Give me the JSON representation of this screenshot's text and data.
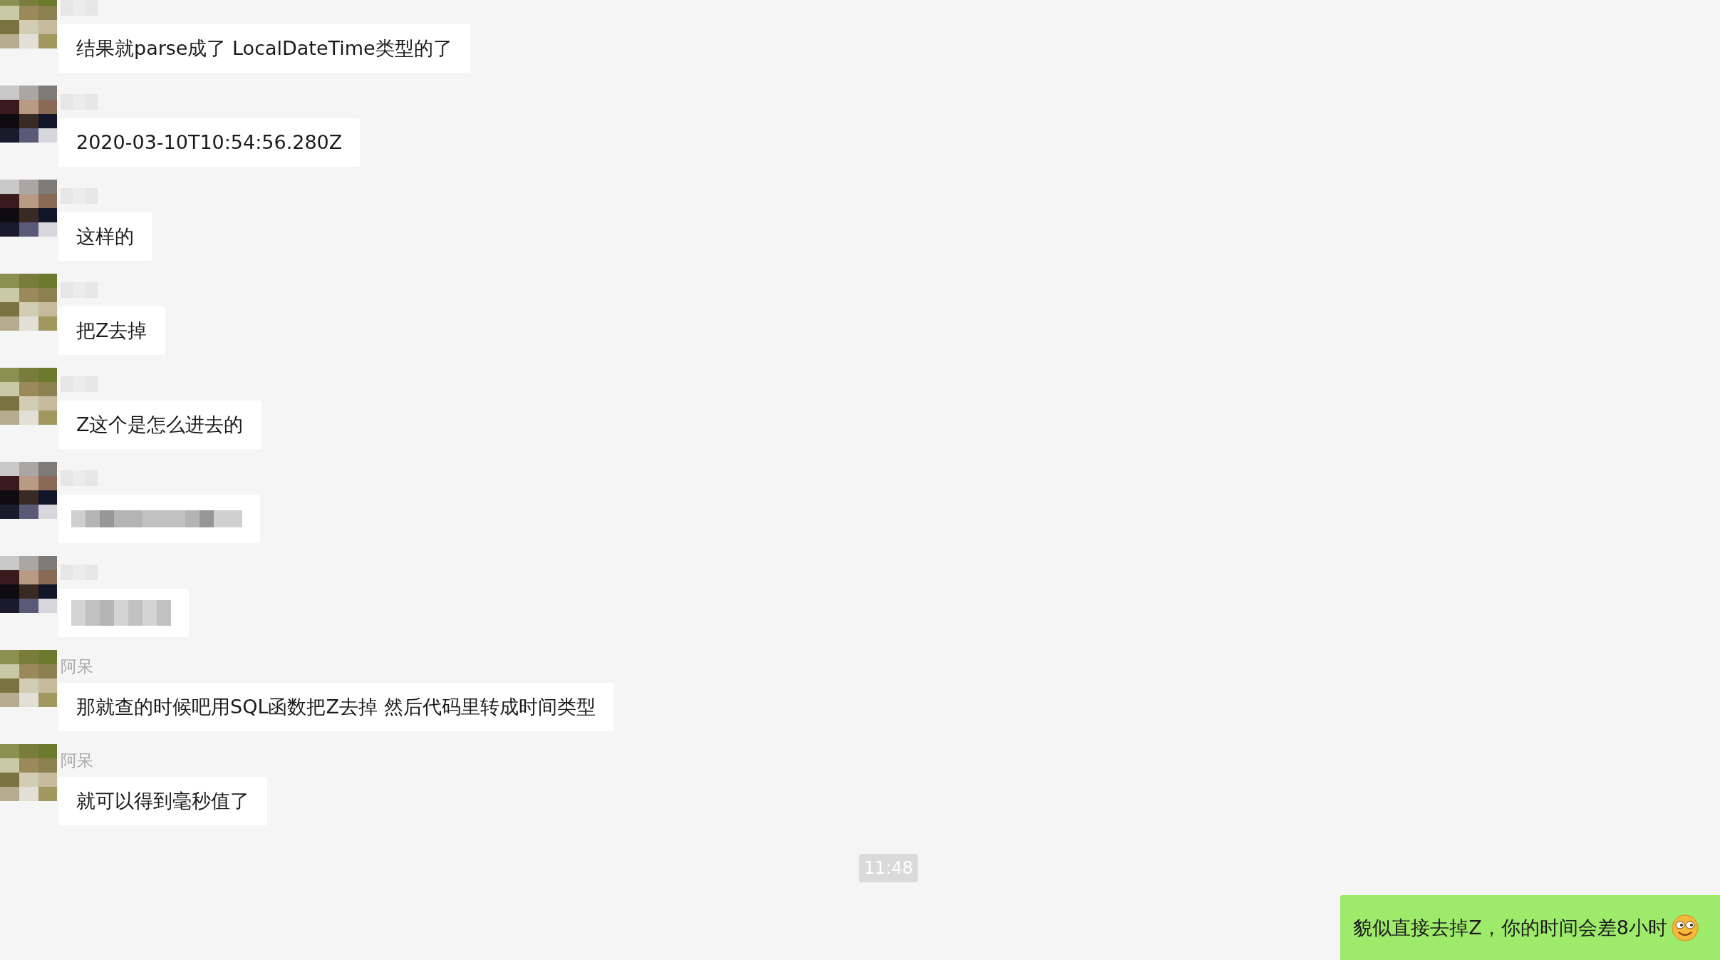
{
  "messages": [
    {
      "avatar": {
        "kind": "olive"
      },
      "sender": {
        "kind": "blurred"
      },
      "kind": "text",
      "text": "结果就parse成了 LocalDateTime类型的了"
    },
    {
      "avatar": {
        "kind": "dark"
      },
      "sender": {
        "kind": "blurred"
      },
      "kind": "text",
      "text": "2020-03-10T10:54:56.280Z"
    },
    {
      "avatar": {
        "kind": "dark"
      },
      "sender": {
        "kind": "blurred"
      },
      "kind": "text",
      "text": "这样的"
    },
    {
      "avatar": {
        "kind": "olive"
      },
      "sender": {
        "kind": "blurred"
      },
      "kind": "text",
      "text": "把Z去掉"
    },
    {
      "avatar": {
        "kind": "olive"
      },
      "sender": {
        "kind": "blurred"
      },
      "kind": "text",
      "text": "Z这个是怎么进去的"
    },
    {
      "avatar": {
        "kind": "dark"
      },
      "sender": {
        "kind": "blurred"
      },
      "kind": "redacted_wide"
    },
    {
      "avatar": {
        "kind": "dark"
      },
      "sender": {
        "kind": "blurred"
      },
      "kind": "redacted_narrow"
    },
    {
      "avatar": {
        "kind": "olive"
      },
      "sender": {
        "kind": "shown",
        "name": "阿呆"
      },
      "kind": "text",
      "text": "那就查的时候吧用SQL函数把Z去掉  然后代码里转成时间类型"
    },
    {
      "avatar": {
        "kind": "olive"
      },
      "sender": {
        "kind": "shown",
        "name": "阿呆"
      },
      "kind": "text",
      "text": "就可以得到毫秒值了"
    }
  ],
  "timestamp": "11:48",
  "own_message": {
    "text": "貌似直接去掉Z，你的时间会差8小时",
    "emoji": {
      "kind": "smile"
    }
  }
}
